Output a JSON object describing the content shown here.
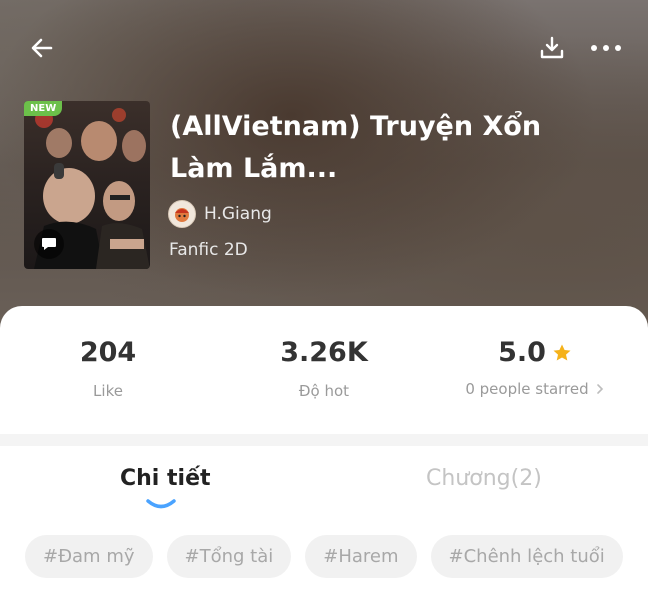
{
  "story": {
    "badge": "NEW",
    "title": "(AllVietnam) Truyện Xổn Làm Lắm...",
    "author": "H.Giang",
    "genre": "Fanfic 2D"
  },
  "stats": {
    "likes": {
      "value": "204",
      "label": "Like"
    },
    "hot": {
      "value": "3.26K",
      "label": "Độ hot"
    },
    "rating": {
      "value": "5.0",
      "label": "0 people starred"
    }
  },
  "tabs": [
    {
      "label": "Chi tiết",
      "active": true
    },
    {
      "label": "Chương(2)",
      "active": false
    }
  ],
  "tags": [
    "#Đam mỹ",
    "#Tổng tài",
    "#Harem",
    "#Chênh lệch tuổi"
  ],
  "colors": {
    "star": "#f5b21a",
    "new_badge": "#6cc04a",
    "tab_indicator": "#4aa3ff",
    "tag_bg": "#f1f1f1"
  },
  "icons": [
    "back-arrow-icon",
    "download-icon",
    "more-icon",
    "comment-icon",
    "star-icon",
    "chevron-right-icon"
  ]
}
